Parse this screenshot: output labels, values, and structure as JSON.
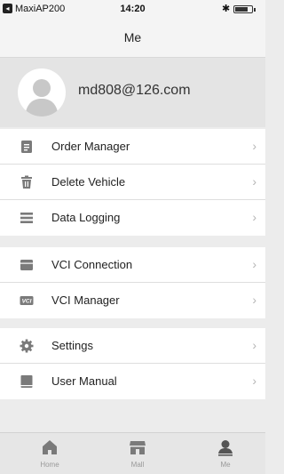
{
  "status_bar": {
    "carrier": "MaxiAP200",
    "time": "14:20",
    "battery_level": 0.75
  },
  "nav": {
    "title": "Me"
  },
  "profile": {
    "email": "md808@126.com"
  },
  "menu_groups": [
    {
      "items": [
        {
          "label": "Order Manager",
          "icon": "clipboard-icon"
        },
        {
          "label": "Delete Vehicle",
          "icon": "trash-icon"
        },
        {
          "label": "Data Logging",
          "icon": "list-icon"
        }
      ]
    },
    {
      "items": [
        {
          "label": "VCI Connection",
          "icon": "vci-connection-icon"
        },
        {
          "label": "VCI Manager",
          "icon": "vci-badge-icon",
          "icon_text": "VCI"
        }
      ]
    },
    {
      "items": [
        {
          "label": "Settings",
          "icon": "gear-icon"
        },
        {
          "label": "User Manual",
          "icon": "book-icon"
        }
      ]
    }
  ],
  "tab_bar": {
    "tabs": [
      {
        "label": "Home",
        "icon": "home-icon"
      },
      {
        "label": "Mall",
        "icon": "store-icon"
      },
      {
        "label": "Me",
        "icon": "user-icon",
        "active": true
      }
    ]
  },
  "colors": {
    "background": "#ececec",
    "icon": "#7a7a7a",
    "active_tab": "#555555",
    "inactive_tab": "#9a9a9a"
  }
}
